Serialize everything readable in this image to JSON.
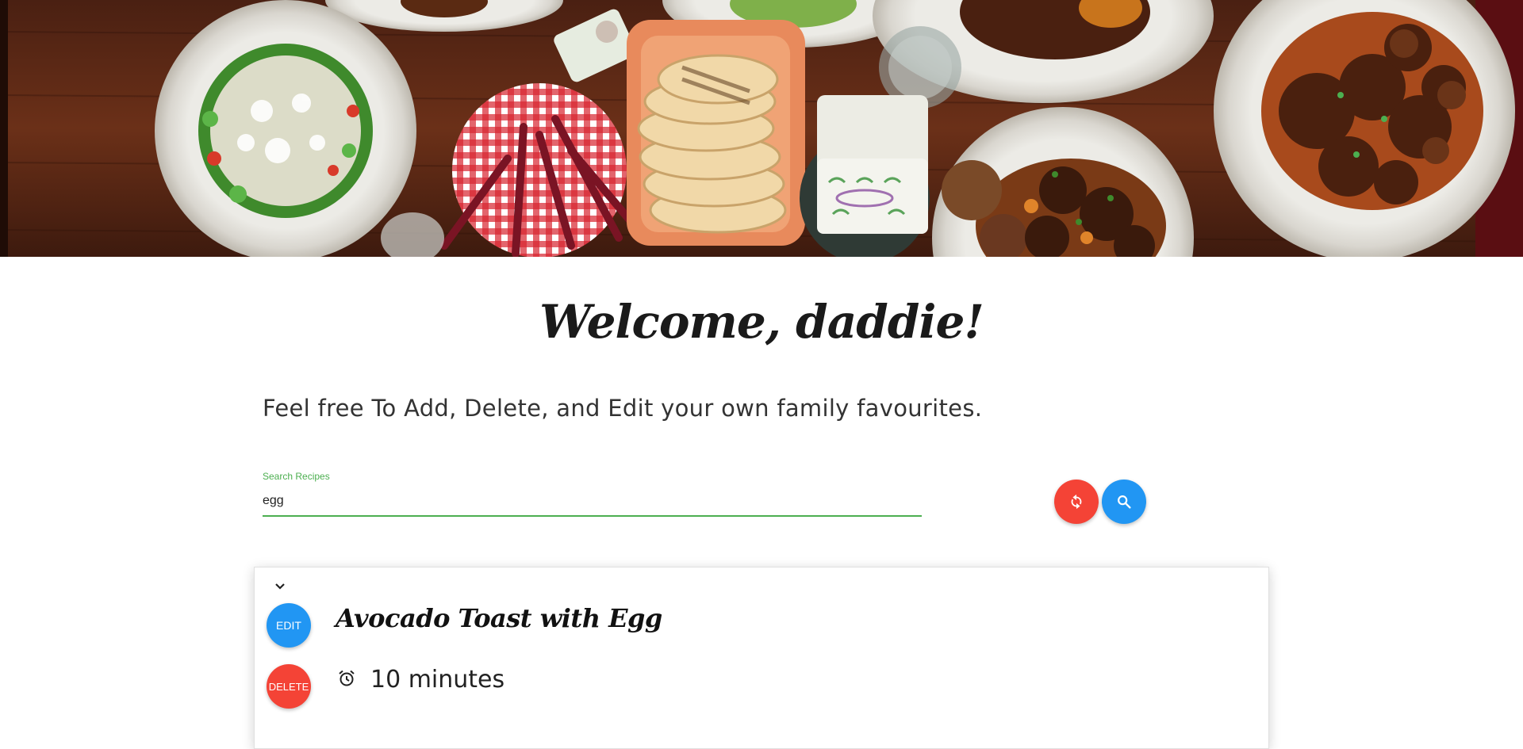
{
  "hero": {
    "image": "food-table-banner"
  },
  "welcome": {
    "text": "Welcome, daddie!"
  },
  "subtitle": {
    "text": "Feel free To Add, Delete, and Edit your own family favourites."
  },
  "search": {
    "label": "Search Recipes",
    "value": "egg",
    "accent_color": "#4caf50",
    "refresh_icon": "refresh-icon",
    "search_icon": "search-icon"
  },
  "recipes": [
    {
      "title": "Avocado Toast with Egg",
      "time": "10 minutes",
      "edit_label": "EDIT",
      "delete_label": "DELETE",
      "toggle_icon": "chevron-down-icon",
      "time_icon": "alarm-clock-icon"
    }
  ],
  "colors": {
    "primary": "#2196f3",
    "danger": "#f44336",
    "accent": "#4caf50"
  }
}
